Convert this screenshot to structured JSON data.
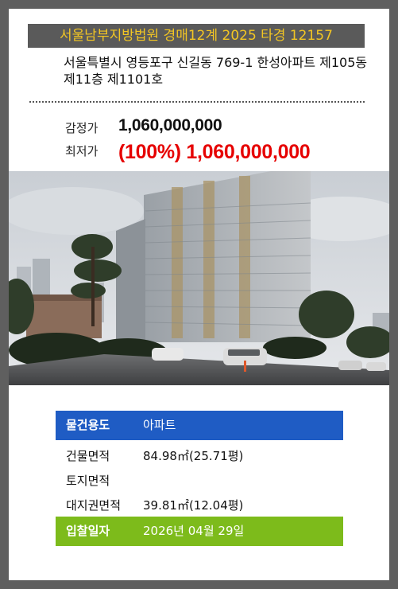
{
  "header": {
    "court_case": "서울남부지방법원 경매12계 2025 타경 12157"
  },
  "property": {
    "address": "서울특별시 영등포구 신길동 769-1 한성아파트 제105동 제11층 제1101호"
  },
  "prices": {
    "appraisal_label": "감정가",
    "appraisal_value": "1,060,000,000",
    "minimum_label": "최저가",
    "minimum_value": "(100%) 1,060,000,000"
  },
  "photo": {
    "subject": "apartment-building-photo"
  },
  "details": {
    "usage_label": "물건용도",
    "usage_value": "아파트",
    "building_area_label": "건물면적",
    "building_area_value": "84.98㎡(25.71평)",
    "land_area_label": "토지면적",
    "land_area_value": "",
    "land_rights_label": "대지권면적",
    "land_rights_value": "39.81㎡(12.04평)",
    "bid_date_label": "입찰일자",
    "bid_date_value": "2026년 04월 29일"
  },
  "colors": {
    "court_banner_bg": "#5a5a5a",
    "court_banner_text": "#f3c623",
    "minimum_price": "#e60000",
    "usage_row_bg": "#1f5cc4",
    "bid_row_bg": "#7dbb1b"
  }
}
